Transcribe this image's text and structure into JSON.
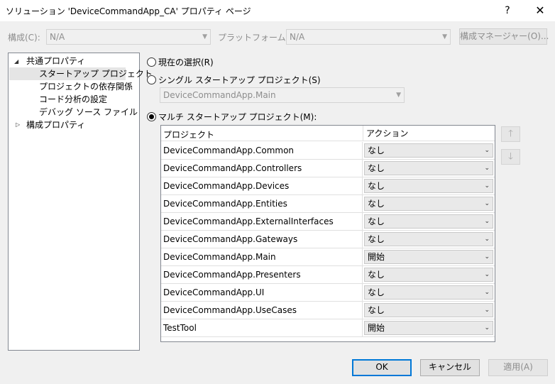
{
  "window": {
    "title": "ソリューション 'DeviceCommandApp_CA' プロパティ ページ",
    "help": "?",
    "close": "✕"
  },
  "top": {
    "config_label": "構成(C):",
    "config_value": "N/A",
    "platform_label": "プラットフォーム(P):",
    "platform_value": "N/A",
    "config_manager": "構成マネージャー(O)..."
  },
  "tree": {
    "common": "共通プロパティ",
    "items": [
      "スタートアップ プロジェクト",
      "プロジェクトの依存関係",
      "コード分析の設定",
      "デバッグ ソース ファイル"
    ],
    "config_props": "構成プロパティ"
  },
  "startup": {
    "current_selection": "現在の選択(R)",
    "single": "シングル スタートアップ プロジェクト(S)",
    "single_value": "DeviceCommandApp.Main",
    "multi": "マルチ スタートアップ プロジェクト(M):"
  },
  "grid": {
    "col_project": "プロジェクト",
    "col_action": "アクション",
    "rows": [
      {
        "project": "DeviceCommandApp.Common",
        "action": "なし"
      },
      {
        "project": "DeviceCommandApp.Controllers",
        "action": "なし"
      },
      {
        "project": "DeviceCommandApp.Devices",
        "action": "なし"
      },
      {
        "project": "DeviceCommandApp.Entities",
        "action": "なし"
      },
      {
        "project": "DeviceCommandApp.ExternalInterfaces",
        "action": "なし"
      },
      {
        "project": "DeviceCommandApp.Gateways",
        "action": "なし"
      },
      {
        "project": "DeviceCommandApp.Main",
        "action": "開始"
      },
      {
        "project": "DeviceCommandApp.Presenters",
        "action": "なし"
      },
      {
        "project": "DeviceCommandApp.UI",
        "action": "なし"
      },
      {
        "project": "DeviceCommandApp.UseCases",
        "action": "なし"
      },
      {
        "project": "TestTool",
        "action": "開始"
      }
    ]
  },
  "buttons": {
    "ok": "OK",
    "cancel": "キャンセル",
    "apply": "適用(A)"
  }
}
